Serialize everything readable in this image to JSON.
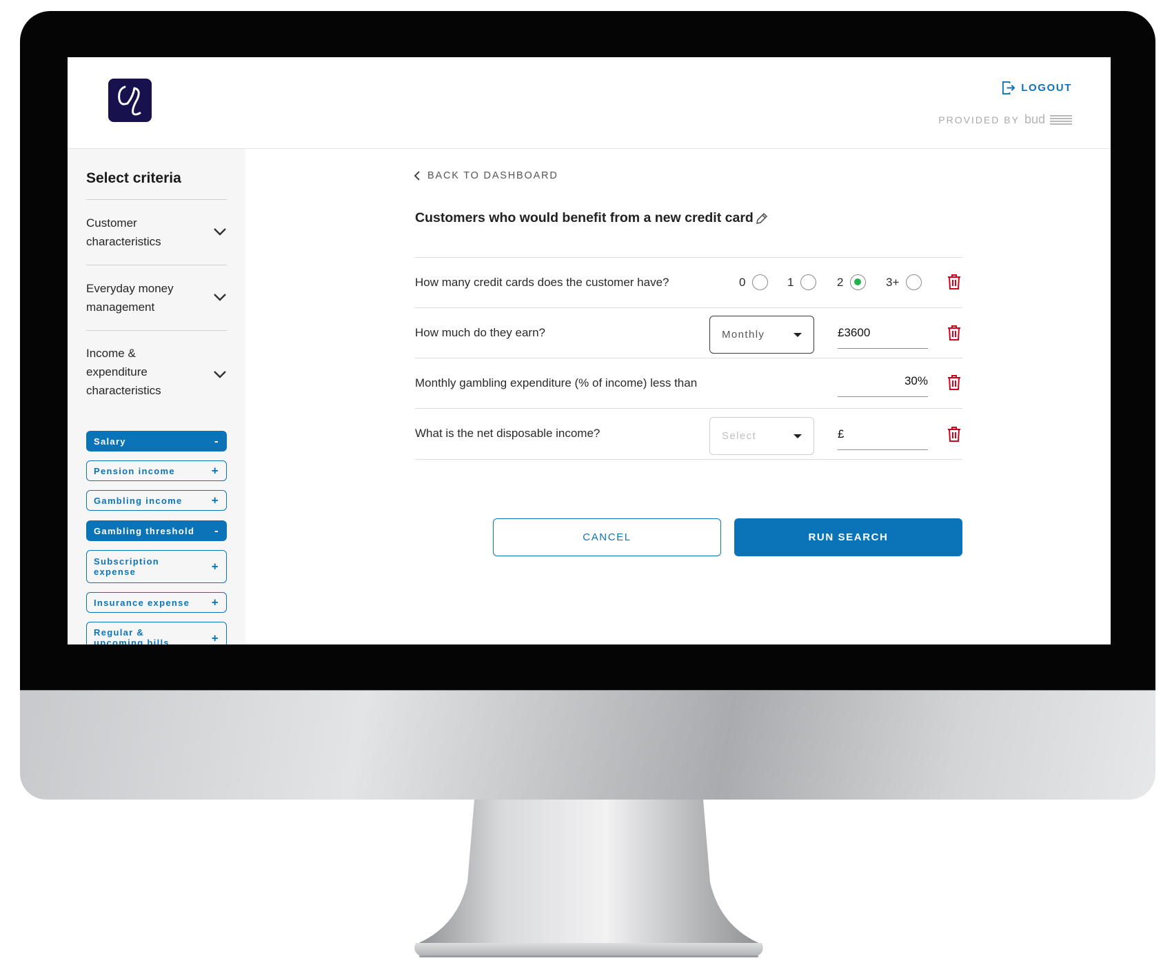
{
  "header": {
    "logout_label": "LOGOUT",
    "provided_by_label": "PROVIDED BY",
    "provider_name": "bud"
  },
  "sidebar": {
    "title": "Select criteria",
    "sections": [
      {
        "label": "Customer characteristics"
      },
      {
        "label": "Everyday money management"
      },
      {
        "label": "Income & expenditure characteristics"
      }
    ],
    "chips": [
      {
        "label": "Salary",
        "sign": "-",
        "active": true
      },
      {
        "label": "Pension income",
        "sign": "+",
        "active": false
      },
      {
        "label": "Gambling income",
        "sign": "+",
        "active": false
      },
      {
        "label": "Gambling threshold",
        "sign": "-",
        "active": true
      },
      {
        "label": "Subscription expense",
        "sign": "+",
        "active": false
      },
      {
        "label": "Insurance expense",
        "sign": "+",
        "active": false
      },
      {
        "label": "Regular & upcoming bills",
        "sign": "+",
        "active": false
      }
    ]
  },
  "main": {
    "back_label": "BACK TO DASHBOARD",
    "title": "Customers who would benefit from a new credit card",
    "criteria": [
      {
        "question": "How many credit cards does the customer have?",
        "options": [
          "0",
          "1",
          "2",
          "3+"
        ],
        "selected": "2"
      },
      {
        "question": "How much do they earn?",
        "period_value": "Monthly",
        "amount_value": "£3600"
      },
      {
        "question": "Monthly gambling expenditure (% of income) less than",
        "percent_value": "30%"
      },
      {
        "question": "What is the net disposable income?",
        "period_placeholder": "Select",
        "amount_value": "£"
      }
    ],
    "cancel_label": "CANCEL",
    "run_label": "RUN SEARCH"
  },
  "colors": {
    "accent": "#0b74b8",
    "logo_bg": "#17124e",
    "danger": "#d0021b",
    "selected_radio": "#22b14c"
  }
}
